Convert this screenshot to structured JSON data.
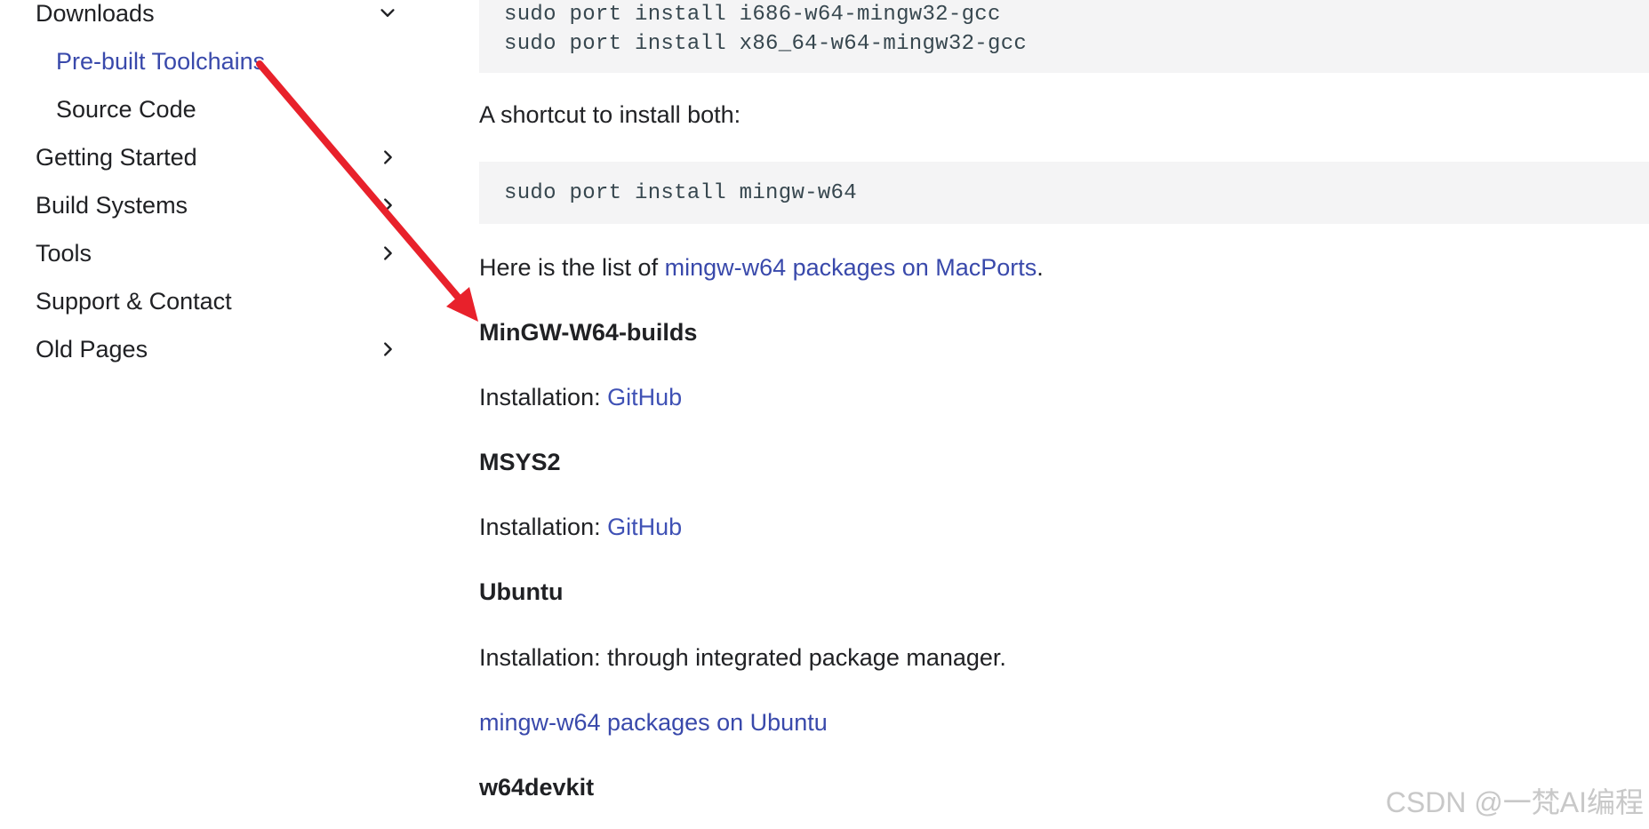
{
  "sidebar": {
    "items": [
      {
        "label": "Downloads",
        "has_chevron": true,
        "chevron": "chevron-down-icon"
      },
      {
        "label": "Pre-built Toolchains",
        "sub": true,
        "active": true
      },
      {
        "label": "Source Code",
        "sub": true
      },
      {
        "label": "Getting Started",
        "has_chevron": true,
        "chevron": "chevron-right-icon"
      },
      {
        "label": "Build Systems",
        "has_chevron": true,
        "chevron": "chevron-right-icon"
      },
      {
        "label": "Tools",
        "has_chevron": true,
        "chevron": "chevron-right-icon"
      },
      {
        "label": "Support & Contact"
      },
      {
        "label": "Old Pages",
        "has_chevron": true,
        "chevron": "chevron-right-icon"
      }
    ]
  },
  "main": {
    "code1": [
      "sudo port install i686-w64-mingw32-gcc",
      "sudo port install x86_64-w64-mingw32-gcc"
    ],
    "shortcut_text": "A shortcut to install both:",
    "code2": [
      "sudo port install mingw-w64"
    ],
    "macports_prefix": "Here is the list of ",
    "macports_link": "mingw-w64 packages on MacPorts",
    "macports_suffix": ".",
    "sections": [
      {
        "heading": "MinGW-W64-builds",
        "install_prefix": "Installation: ",
        "install_link": "GitHub"
      },
      {
        "heading": "MSYS2",
        "install_prefix": "Installation: ",
        "install_link": "GitHub"
      },
      {
        "heading": "Ubuntu",
        "install_text": "Installation: through integrated package manager.",
        "extra_link": "mingw-w64 packages on Ubuntu"
      },
      {
        "heading": "w64devkit"
      }
    ]
  },
  "annotation": {
    "arrow_color": "#e8212b"
  },
  "watermark": "CSDN @一梵AI编程",
  "colors": {
    "link": "#3949ab",
    "code_bg": "#f4f4f5",
    "text": "#202124"
  }
}
